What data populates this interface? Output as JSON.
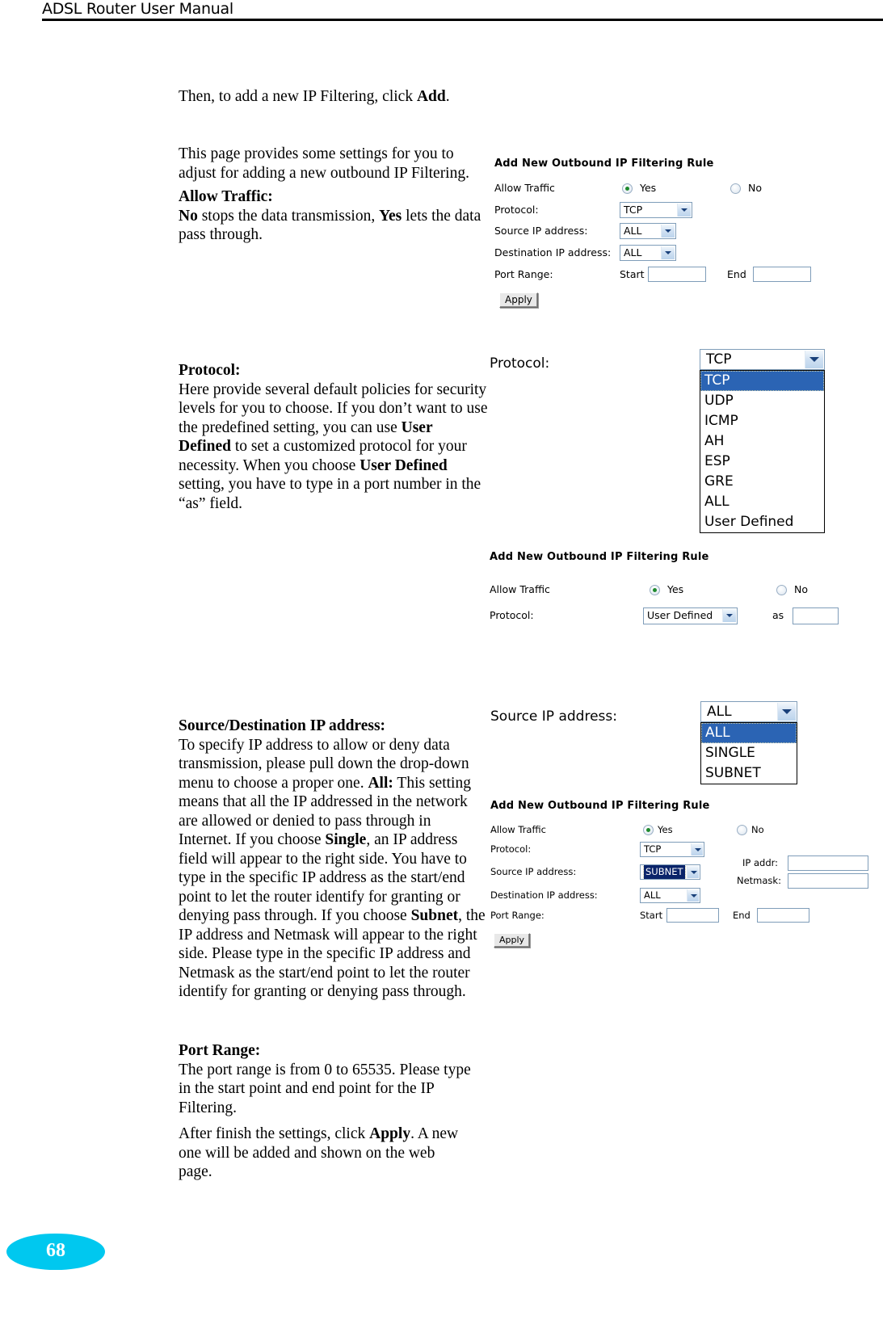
{
  "header": {
    "title": "ADSL Router User Manual"
  },
  "page_number": "68",
  "body": {
    "intro": "Then, to add a new IP Filtering, click ",
    "intro_bold": "Add",
    "intro_tail": ".",
    "page_desc": "This page provides some settings for you to adjust for adding a new outbound IP Filtering.",
    "allow_traffic_heading": "Allow Traffic:",
    "allow_traffic_b1": "No",
    "allow_traffic_t1": " stops the data transmission, ",
    "allow_traffic_b2": "Yes",
    "allow_traffic_t2": " lets the data pass through.",
    "protocol_heading": "Protocol:",
    "protocol_t1": "Here provide several default policies for security levels for you to choose. If you don’t want to use the predefined setting, you can use ",
    "protocol_b1": "User Defined",
    "protocol_t2": " to set a customized protocol for your necessity. When you choose ",
    "protocol_b2": "User Defined",
    "protocol_t3": " setting, you have to type in a port number in the “as” field.",
    "srcdest_heading": "Source/Destination IP address:",
    "srcdest_t1": "To specify IP address to allow or deny data transmission, please pull down the drop-down menu to choose a proper one. ",
    "srcdest_b1": "All:",
    "srcdest_t2": " This setting means that all the IP addressed in the network are allowed or denied to pass through in Internet. If you choose ",
    "srcdest_b2": "Single",
    "srcdest_t3": ", an IP address field will appear to the right side. You have to type in the specific IP address as the start/end point to let the router identify for granting or denying pass through. If you choose ",
    "srcdest_b3": "Subnet",
    "srcdest_t4": ", the IP address and Netmask will appear to the right side. Please type in the specific IP address and Netmask as the start/end point to let the router identify for granting or denying pass through.",
    "port_heading": "Port Range:",
    "port_text": "The port range is from 0 to 65535. Please type in the start point and end point for the IP Filtering.",
    "after_t1": "After finish the settings, click ",
    "after_b1": "Apply",
    "after_t2": ".    A new one will be added and shown on the web page."
  },
  "form1": {
    "title": "Add New Outbound IP Filtering Rule",
    "allow_traffic_label": "Allow Traffic",
    "yes_label": "Yes",
    "no_label": "No",
    "protocol_label": "Protocol:",
    "protocol_value": "TCP",
    "source_label": "Source IP address:",
    "source_value": "ALL",
    "dest_label": "Destination IP address:",
    "dest_value": "ALL",
    "port_range_label": "Port Range:",
    "start_label": "Start",
    "start_value": "",
    "end_label": "End",
    "end_value": "",
    "apply_label": "Apply"
  },
  "protocol_dropdown": {
    "label": "Protocol:",
    "selected": "TCP",
    "options": [
      "TCP",
      "UDP",
      "ICMP",
      "AH",
      "ESP",
      "GRE",
      "ALL",
      "User Defined"
    ]
  },
  "form2": {
    "title": "Add New Outbound IP Filtering Rule",
    "allow_traffic_label": "Allow Traffic",
    "yes_label": "Yes",
    "no_label": "No",
    "protocol_label": "Protocol:",
    "protocol_value": "User Defined",
    "as_label": "as",
    "as_value": ""
  },
  "source_dropdown": {
    "label": "Source IP address:",
    "selected": "ALL",
    "options": [
      "ALL",
      "SINGLE",
      "SUBNET"
    ]
  },
  "form3": {
    "title": "Add New Outbound IP Filtering Rule",
    "allow_traffic_label": "Allow Traffic",
    "yes_label": "Yes",
    "no_label": "No",
    "protocol_label": "Protocol:",
    "protocol_value": "TCP",
    "source_label": "Source IP address:",
    "source_value": "SUBNET",
    "ip_addr_label": "IP addr:",
    "ip_addr_value": "",
    "netmask_label": "Netmask:",
    "netmask_value": "",
    "dest_label": "Destination IP address:",
    "dest_value": "ALL",
    "port_range_label": "Port Range:",
    "start_label": "Start",
    "start_value": "",
    "end_label": "End",
    "end_value": "",
    "apply_label": "Apply"
  },
  "colors": {
    "page_badge": "#00c8ef",
    "select_border": "#7f9db9",
    "list_selection": "#2b64b4",
    "radio_dot": "#1f8a2e"
  }
}
